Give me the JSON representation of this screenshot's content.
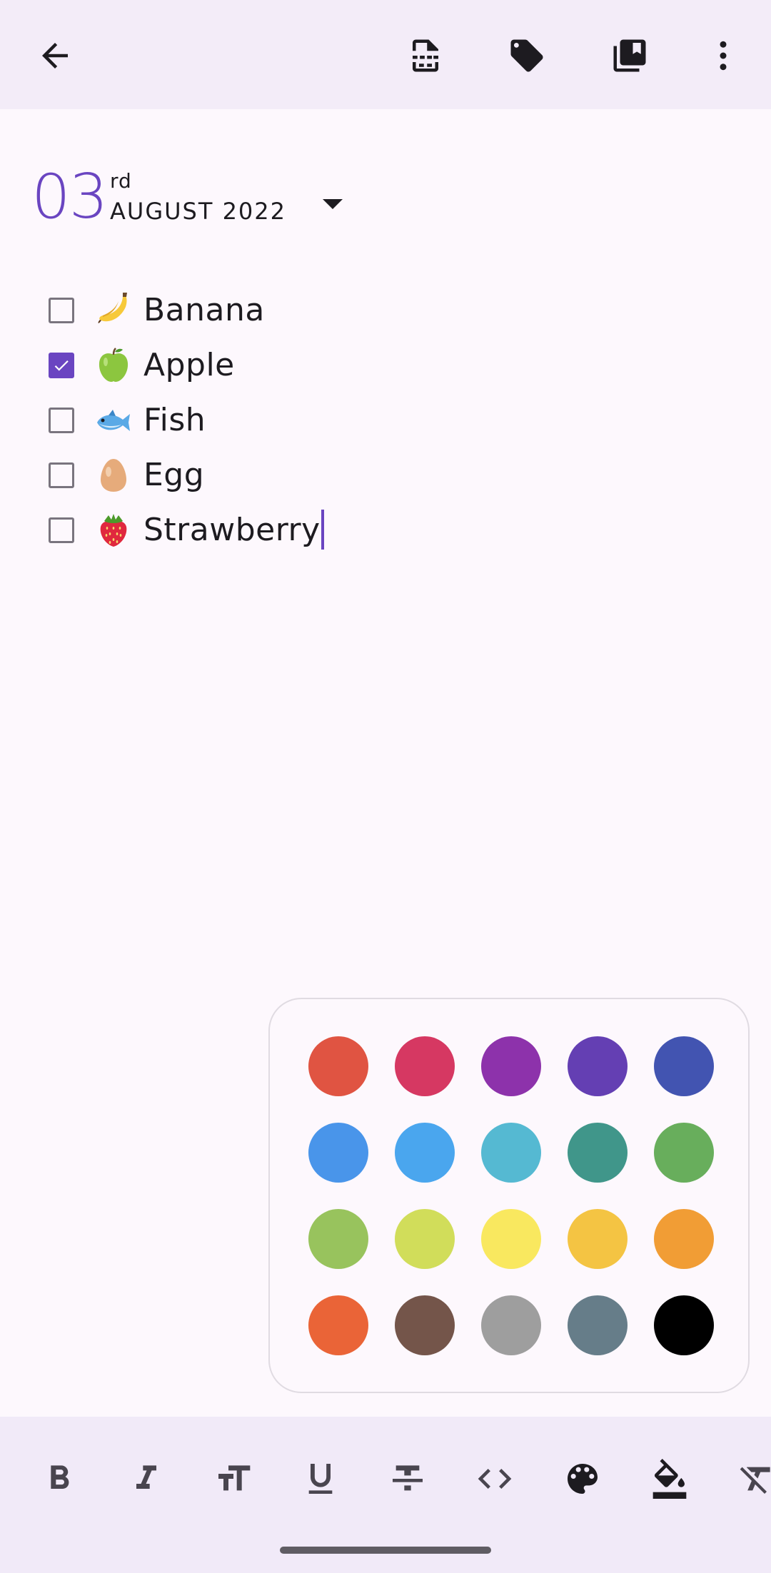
{
  "toolbar": {
    "back": "back-icon",
    "actions": [
      "file-template-icon",
      "tag-icon",
      "collections-icon",
      "more-vert-icon"
    ]
  },
  "date": {
    "day": "03",
    "suffix": "rd",
    "month_year": "AUGUST 2022",
    "accent": "#6a45c1"
  },
  "todos": [
    {
      "emoji": "banana",
      "text": "Banana",
      "checked": false
    },
    {
      "emoji": "green-apple",
      "text": "Apple",
      "checked": true
    },
    {
      "emoji": "fish",
      "text": "Fish",
      "checked": false
    },
    {
      "emoji": "egg",
      "text": "Egg",
      "checked": false
    },
    {
      "emoji": "strawberry",
      "text": "Strawberry",
      "checked": false
    }
  ],
  "palette": {
    "colors": [
      "#e05442",
      "#d63862",
      "#8d32ab",
      "#643fb3",
      "#4254b1",
      "#4995ea",
      "#4aa6ee",
      "#55b9d2",
      "#40968a",
      "#68ae5c",
      "#98c35d",
      "#d1dd5a",
      "#f9e85f",
      "#f4c443",
      "#f19d35",
      "#ea6437",
      "#74554a",
      "#9e9e9e",
      "#667d89",
      "#000000"
    ]
  },
  "formatting": [
    "bold-icon",
    "italic-icon",
    "text-size-icon",
    "underline-icon",
    "strikethrough-icon",
    "code-icon",
    "palette-icon",
    "fill-color-icon",
    "clear-format-icon"
  ]
}
